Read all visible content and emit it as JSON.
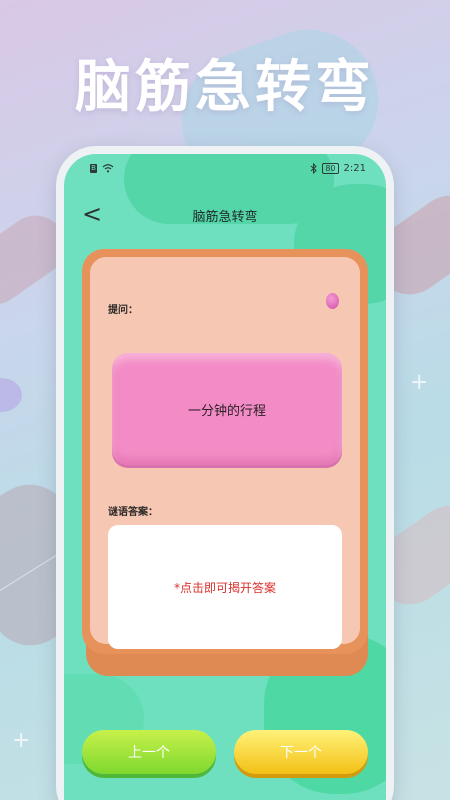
{
  "banner": {
    "title": "脑筋急转弯"
  },
  "status_bar": {
    "time": "2:21",
    "battery": "80",
    "sim": "B"
  },
  "nav": {
    "back_symbol": "<",
    "title": "脑筋急转弯"
  },
  "question": {
    "label": "提问：",
    "text": "一分钟的行程"
  },
  "answer": {
    "label": "谜语答案：",
    "placeholder": "*点击即可揭开答案"
  },
  "buttons": {
    "prev": "上一个",
    "next": "下一个"
  },
  "colors": {
    "screen_bg": "#6fe0bf",
    "card_border": "#e8925b",
    "card_inner": "#f6c7b3",
    "question_box": "#f38cc6",
    "answer_text": "#d9302c",
    "prev_button": "#8fdd30",
    "next_button": "#f5d031"
  },
  "icons": [
    "sim-icon",
    "wifi-icon",
    "bluetooth-icon",
    "battery-icon",
    "back-arrow-icon",
    "pink-dot-icon",
    "sparkle-icon"
  ]
}
